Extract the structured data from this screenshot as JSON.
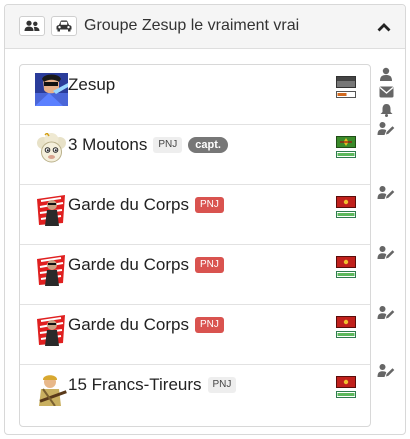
{
  "header": {
    "title": "Groupe Zesup le vraiment vrai",
    "icons": [
      "users-icon",
      "car-icon",
      "chevron-up-icon"
    ]
  },
  "members": [
    {
      "name": "Zesup",
      "badges": [],
      "avatar": "avatar-zesup",
      "flag": "gray"
    },
    {
      "name": "3 Moutons",
      "badges": [
        {
          "text": "PNJ",
          "style": "gray"
        },
        {
          "text": "capt.",
          "style": "capt"
        }
      ],
      "avatar": "avatar-sheep",
      "flag": "green"
    },
    {
      "name": "Garde du Corps",
      "badges": [
        {
          "text": "PNJ",
          "style": "red"
        }
      ],
      "avatar": "avatar-guard",
      "flag": "red"
    },
    {
      "name": "Garde du Corps",
      "badges": [
        {
          "text": "PNJ",
          "style": "red"
        }
      ],
      "avatar": "avatar-guard",
      "flag": "red"
    },
    {
      "name": "Garde du Corps",
      "badges": [
        {
          "text": "PNJ",
          "style": "red"
        }
      ],
      "avatar": "avatar-guard",
      "flag": "red"
    },
    {
      "name": "15 Francs-Tireurs",
      "badges": [
        {
          "text": "PNJ",
          "style": "gray"
        }
      ],
      "avatar": "avatar-sniper",
      "flag": "red"
    }
  ],
  "colors": {
    "badge_red": "#d9534f",
    "badge_gray": "#eeeeee",
    "capt": "#777777",
    "icon": "#666666"
  }
}
